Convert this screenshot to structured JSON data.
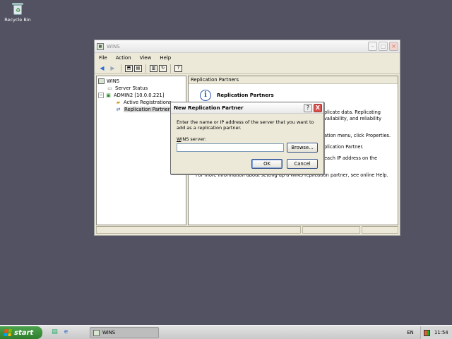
{
  "desktop": {
    "recycle_bin_label": "Recycle Bin"
  },
  "window": {
    "title": "WINS",
    "menu": [
      "File",
      "Action",
      "View",
      "Help"
    ],
    "tree": {
      "root": "WINS",
      "server_status": "Server Status",
      "server": "ADMIN2 [10.0.0.221]",
      "active_registrations": "Active Registrations",
      "replication_partners": "Replication Partners"
    },
    "content": {
      "header": "Replication Partners",
      "heading": "Replication Partners",
      "lines_right": [
        "plicate data. Replicating",
        "vailability, and reliability",
        "ation menu, click Properties.",
        "plication Partner.",
        "each IP address on the"
      ],
      "more_info": "For more information about setting up a WINS replication partner, see online Help."
    }
  },
  "dialog": {
    "title": "New Replication Partner",
    "help_label": "?",
    "close_label": "X",
    "message": "Enter the name or IP address of the server that you want to add as a replication partner.",
    "field_label_accel": "W",
    "field_label_rest": "INS server:",
    "field_value": "",
    "browse_label": "Browse...",
    "ok_label": "OK",
    "cancel_label": "Cancel"
  },
  "taskbar": {
    "start_label": "start",
    "task_label": "WINS",
    "language": "EN",
    "clock": "11:54"
  }
}
